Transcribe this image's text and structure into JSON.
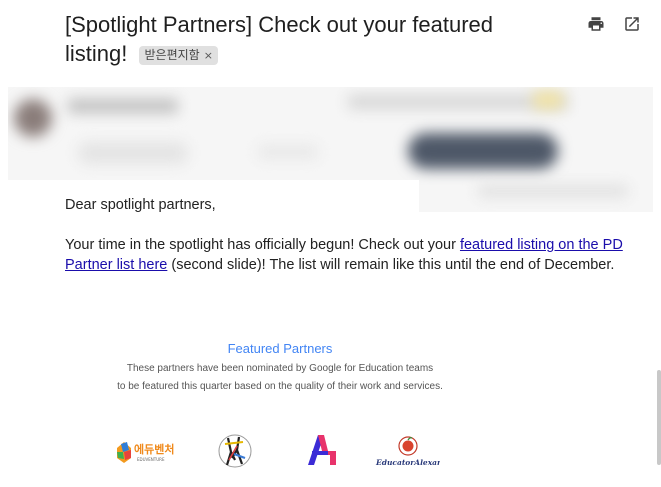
{
  "email": {
    "subject": "[Spotlight Partners] Check out your featured listing!",
    "label": "받은편지함",
    "label_remove": "×"
  },
  "toolbar": {
    "print_icon": "printer-icon",
    "popout_icon": "open-in-new-window-icon"
  },
  "body": {
    "greeting": "Dear spotlight partners,",
    "para_before_link": "Your time in the spotlight has officially begun!  Check out your ",
    "link_text": "featured listing on the PD Partner list here",
    "para_after_link": " (second slide)!  The list will remain like this until the end of December."
  },
  "featured": {
    "title": "Featured Partners",
    "description_line1": "These partners have been nominated by Google for Education teams",
    "description_line2": "to be featured this quarter based on the quality of their work and services."
  },
  "logos": {
    "edu_main": "에듀벤처",
    "edu_sub": "EDUVENTURE",
    "educator_alexander": "EducatorAlexander"
  },
  "colors": {
    "link": "#1a0dab",
    "featured_title": "#4285f4"
  }
}
